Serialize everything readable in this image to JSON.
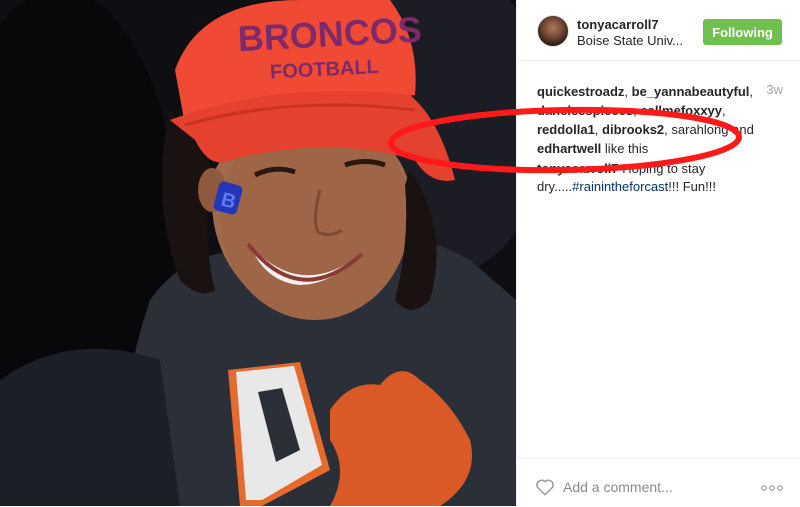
{
  "post": {
    "username": "tonyacarroll7",
    "location": "Boise State Univ...",
    "follow_label": "Following",
    "time_ago": "3w",
    "likes": {
      "users": [
        "quickestroadz",
        "be_yannabeautyful",
        "daneicespieces",
        "callmefoxxyy",
        "reddolla1",
        "dibrooks2",
        "sarahlong",
        "edhartwell"
      ],
      "suffix": "like this",
      "and": "and"
    },
    "caption": {
      "user": "tonyacarroll7",
      "text_before": "Hoping to stay dry.....",
      "hashtag": "#rainintheforcast",
      "text_after": "!!! Fun!!!"
    },
    "comment_placeholder": "Add a comment...",
    "photo": {
      "cap_text_top": "BRONCOS",
      "cap_text_bottom": "FOOTBALL",
      "earring_letter": "B"
    }
  },
  "icons": {
    "like": "heart-icon",
    "more": "more-options-icon"
  },
  "colors": {
    "follow_button": "#70c050",
    "hashtag": "#003569",
    "annotation": "#ff1a1a",
    "cap": "#f04a35"
  }
}
